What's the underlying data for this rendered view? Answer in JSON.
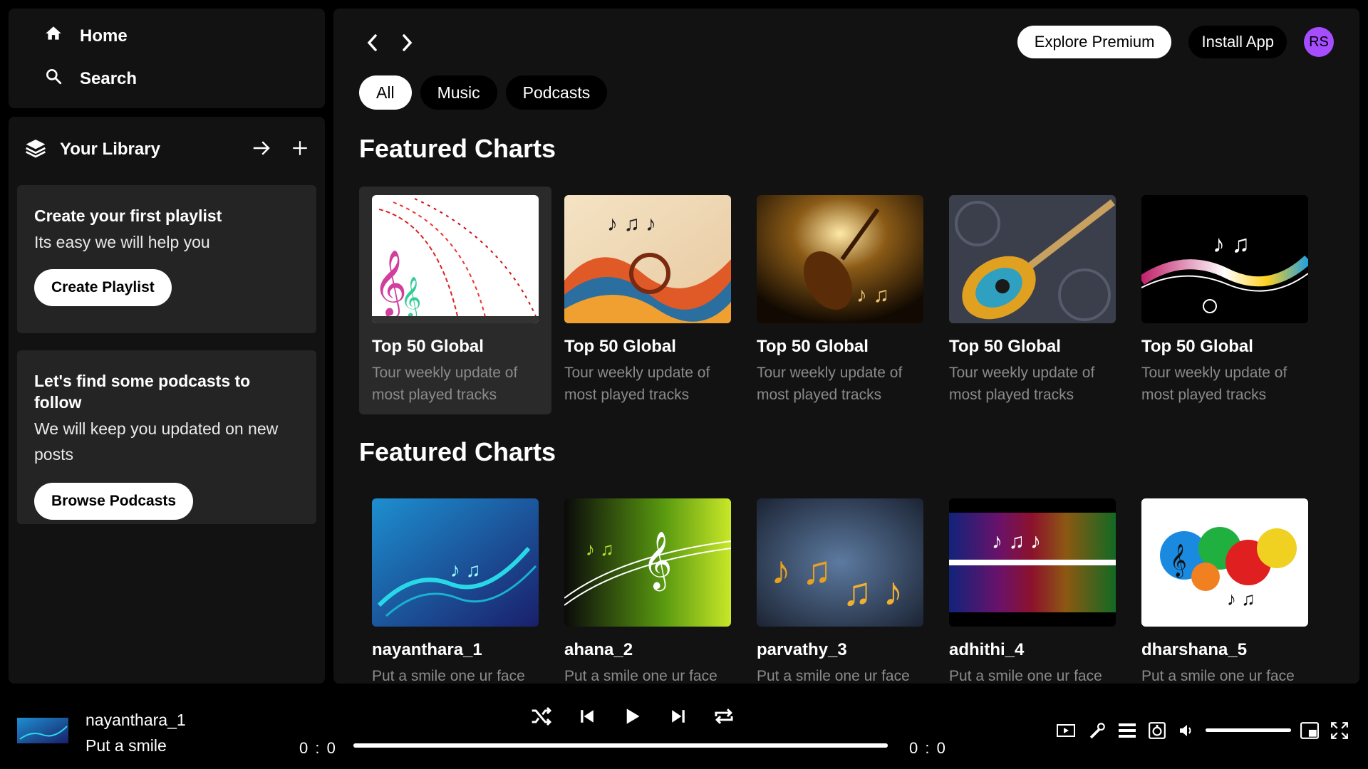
{
  "nav": {
    "home": "Home",
    "search": "Search"
  },
  "library": {
    "title": "Your Library",
    "playlist_block": {
      "title": "Create your first playlist",
      "subtitle": "Its easy we will help you",
      "button": "Create Playlist"
    },
    "podcast_block": {
      "title": "Let's find some podcasts to follow",
      "subtitle": "We will keep you updated on new posts",
      "button": "Browse Podcasts"
    }
  },
  "header": {
    "explore_premium": "Explore Premium",
    "install_app": "Install App",
    "avatar_initials": "RS"
  },
  "filters": [
    "All",
    "Music",
    "Podcasts"
  ],
  "sections": [
    {
      "title": "Featured Charts",
      "cards": [
        {
          "title": "Top 50 Global",
          "desc": "Tour weekly update of most played tracks"
        },
        {
          "title": "Top 50 Global",
          "desc": "Tour weekly update of most played tracks"
        },
        {
          "title": "Top 50 Global",
          "desc": "Tour weekly update of most played tracks"
        },
        {
          "title": "Top 50 Global",
          "desc": "Tour weekly update of most played tracks"
        },
        {
          "title": "Top 50 Global",
          "desc": "Tour weekly update of most played tracks"
        }
      ]
    },
    {
      "title": "Featured Charts",
      "cards": [
        {
          "title": "nayanthara_1",
          "desc": "Put a smile one ur face"
        },
        {
          "title": "ahana_2",
          "desc": "Put a smile one ur face"
        },
        {
          "title": "parvathy_3",
          "desc": "Put a smile one ur face"
        },
        {
          "title": "adhithi_4",
          "desc": "Put a smile one ur face"
        },
        {
          "title": "dharshana_5",
          "desc": "Put a smile one ur face"
        }
      ]
    }
  ],
  "player": {
    "track_title": "nayanthara_1",
    "track_artist": "Put a smile",
    "time_current": "0 : 0",
    "time_total": "0 : 0",
    "progress": 1.0,
    "volume": 1.0
  },
  "colors": {
    "background": "#000000",
    "panel": "#121212",
    "card": "#242424",
    "avatar": "#a64dff"
  }
}
